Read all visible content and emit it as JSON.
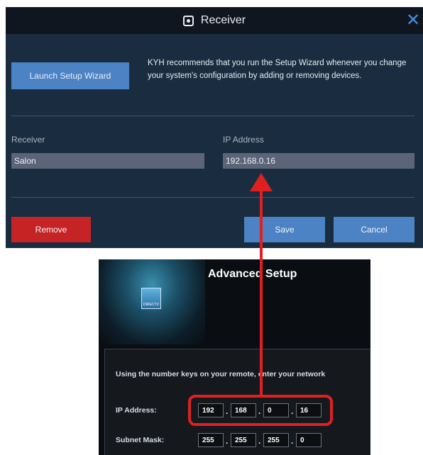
{
  "dialog": {
    "title": "Receiver",
    "title_icon": "receiver-icon",
    "close_glyph": "✕",
    "launch_wizard_label": "Launch Setup Wizard",
    "wizard_message": "KYH recommends that you run the Setup Wizard whenever you change your system's configuration by adding or removing devices.",
    "receiver_label": "Receiver",
    "receiver_value": "Salon",
    "ip_label": "IP Address",
    "ip_value": "192.168.0.16",
    "remove_label": "Remove",
    "save_label": "Save",
    "cancel_label": "Cancel"
  },
  "advanced": {
    "title": "Advanced Setup",
    "logo_text": "DIRECTV",
    "instructions": "Using the number keys on your remote, enter your network",
    "ip_label": "IP Address:",
    "ip_octets": [
      "192",
      "168",
      "0",
      "16"
    ],
    "subnet_label": "Subnet Mask:",
    "subnet_octets": [
      "255",
      "255",
      "255",
      "0"
    ]
  },
  "colors": {
    "dialog_bg": "#1a2d40",
    "titlebar_bg": "#0f1620",
    "accent_blue": "#4c83c4",
    "danger_red": "#c62424",
    "annotation_red": "#e02020"
  }
}
